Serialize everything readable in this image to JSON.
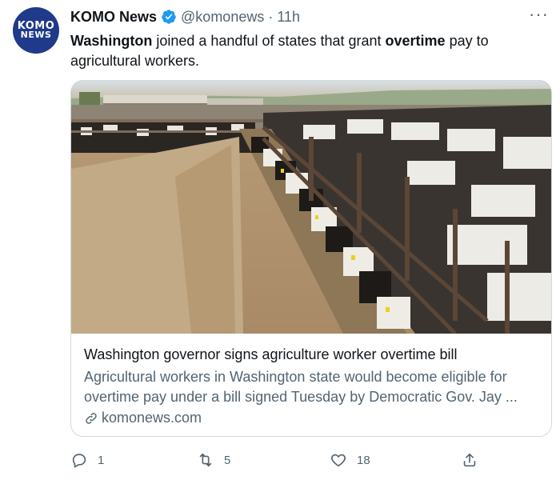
{
  "author": {
    "name": "KOMO News",
    "handle": "@komonews",
    "time": "11h",
    "separator": "·",
    "avatar_line1": "KOMO",
    "avatar_line2": "NEWS",
    "verified": true
  },
  "tweet": {
    "text_bold_1": "Washington",
    "text_mid": " joined a handful of states that grant ",
    "text_bold_2": "overtime",
    "text_end": " pay to agricultural workers."
  },
  "card": {
    "image_alt": "Dairy cows eating at a feedlot",
    "title": "Washington governor signs agriculture worker overtime bill",
    "description": "Agricultural workers in Washington state would become eligible for overtime pay under a bill signed Tuesday by Democratic Gov. Jay ...",
    "domain": "komonews.com"
  },
  "actions": {
    "reply_count": "1",
    "retweet_count": "5",
    "like_count": "18"
  },
  "icons": {
    "more": "more-options-icon",
    "verified": "verified-badge-icon",
    "link": "link-icon",
    "reply": "reply-icon",
    "retweet": "retweet-icon",
    "like": "like-icon",
    "share": "share-icon"
  },
  "colors": {
    "text_primary": "#0f1419",
    "text_secondary": "#536471",
    "verified": "#1d9bf0",
    "border": "#cfd9de",
    "avatar_bg": "#1f3a8a"
  }
}
